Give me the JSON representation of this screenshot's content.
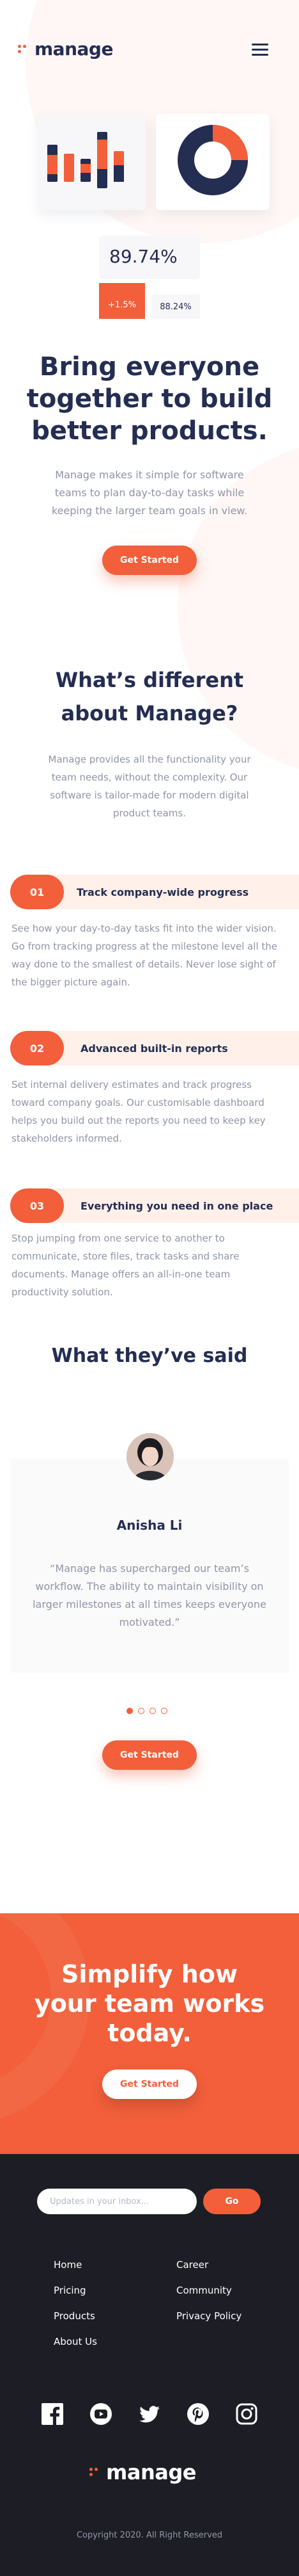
{
  "brand": {
    "name": "manage",
    "accent": "#f25f3a",
    "navy": "#242d52",
    "gray_text": "#9095a7",
    "footer_bg": "#1d1e25"
  },
  "header": {
    "menu_icon": "hamburger-menu-icon"
  },
  "hero_illustration": {
    "stat_percent": "89.74%",
    "chip_change": "+1.5%",
    "chip_value": "88.24%"
  },
  "hero": {
    "title": "Bring everyone together to build better products.",
    "description": "Manage makes it simple for software teams to plan day-to-day tasks while keeping the larger team goals in view.",
    "cta": "Get Started"
  },
  "different": {
    "title": "What’s different about Manage?",
    "description": "Manage provides all the functionality your team needs, without the complexity. Our software is tailor-made for modern digital product teams."
  },
  "features": [
    {
      "number": "01",
      "title": "Track company-wide progress",
      "description": "See how your day-to-day tasks fit into the wider vision. Go from tracking progress at the milestone level all the way done to the smallest of details. Never lose sight of the bigger picture again."
    },
    {
      "number": "02",
      "title": "Advanced built-in reports",
      "description": "Set internal delivery estimates and track progress toward company goals. Our customisable dashboard helps you build out the reports you need to keep key stakeholders informed."
    },
    {
      "number": "03",
      "title": "Everything you need in one place",
      "description": "Stop jumping from one service to another to communicate, store files, track tasks and share documents. Manage offers an all-in-one team productivity solution."
    }
  ],
  "testimonials": {
    "title": "What they’ve said",
    "name": "Anisha Li",
    "quote": "“Manage has supercharged our team’s workflow. The ability to maintain  visibility on larger milestones at all times keeps everyone motivated.”",
    "cta": "Get Started",
    "active_slide": 1,
    "slide_count": 4
  },
  "cta_band": {
    "title": "Simplify how your team works today.",
    "button": "Get Started"
  },
  "footer": {
    "newsletter_placeholder": "Updates in your inbox...",
    "go_label": "Go",
    "links_col1": [
      "Home",
      "Pricing",
      "Products",
      "About Us"
    ],
    "links_col2": [
      "Career",
      "Community",
      "Privacy Policy"
    ],
    "socials": [
      "facebook-icon",
      "youtube-icon",
      "twitter-icon",
      "pinterest-icon",
      "instagram-icon"
    ],
    "copyright": "Copyright 2020. All Right Reserved"
  }
}
